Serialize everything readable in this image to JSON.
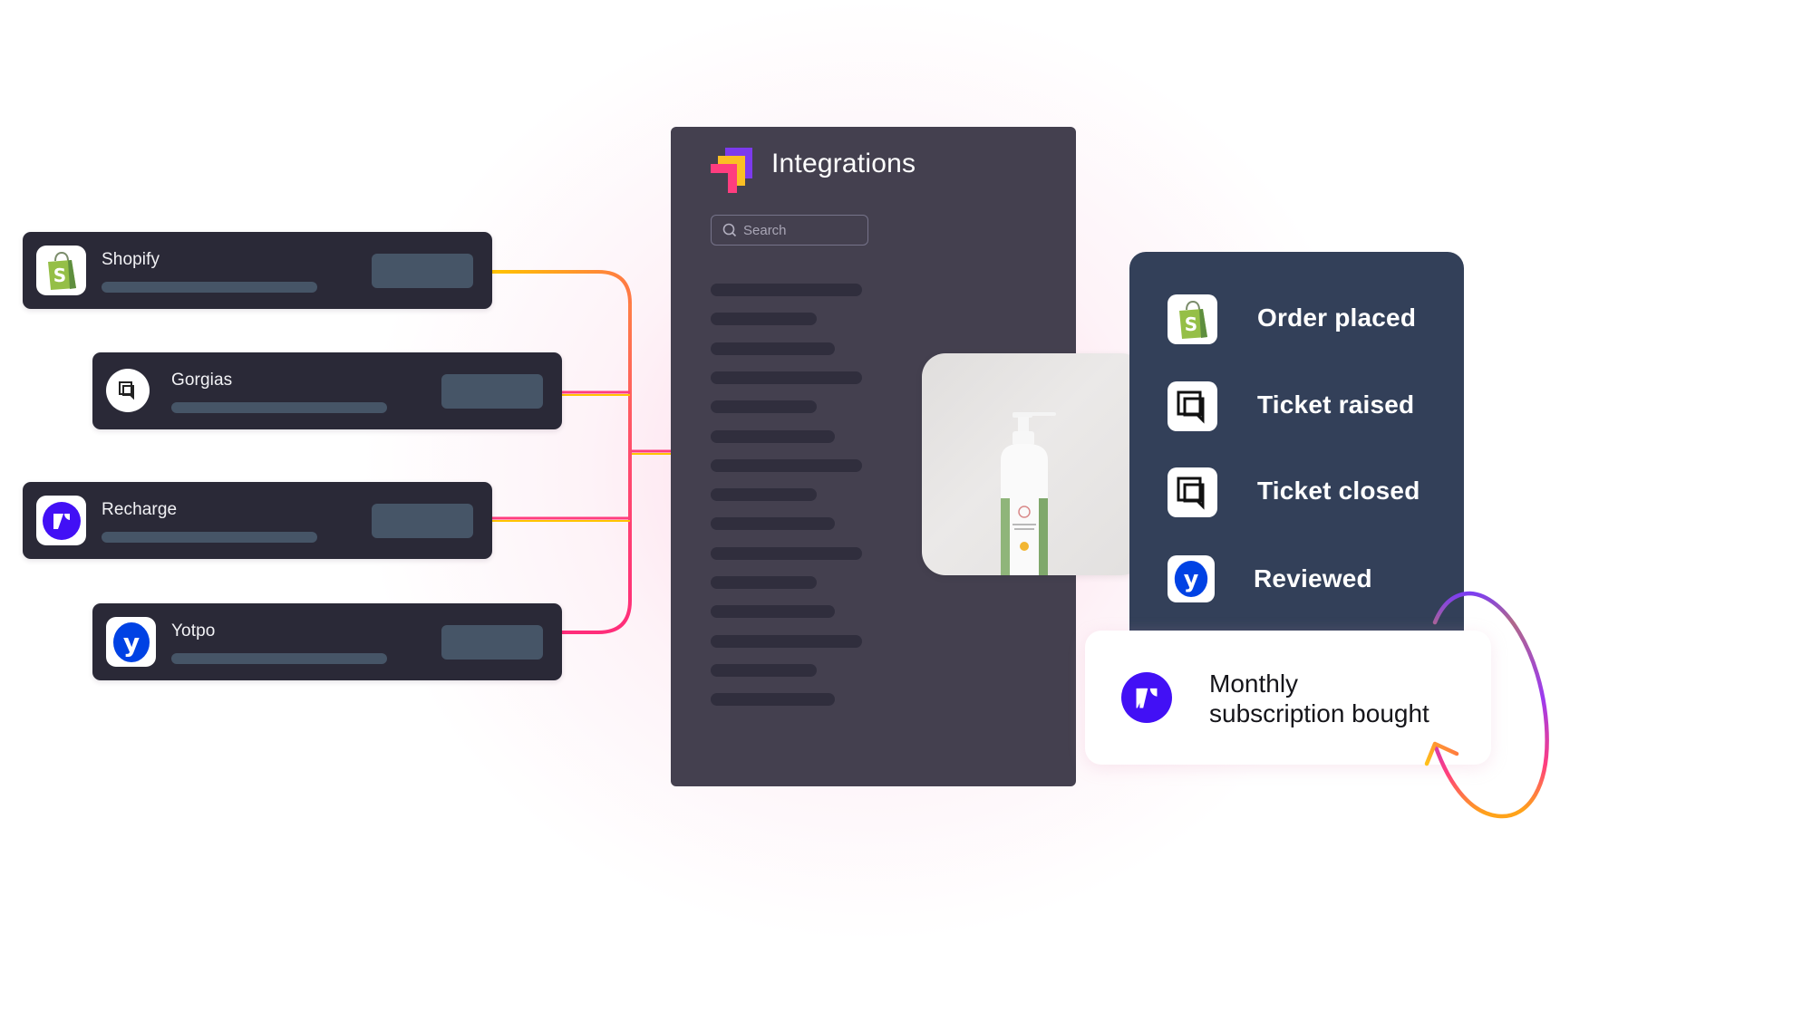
{
  "integrations_panel": {
    "title": "Integrations",
    "search": {
      "placeholder": "Search",
      "value": ""
    },
    "logo_icon": "integrations-logo-icon",
    "placeholder_rows": 15
  },
  "integration_cards": [
    {
      "name": "Shopify",
      "icon": "shopify-bag-icon"
    },
    {
      "name": "Gorgias",
      "icon": "gorgias-chat-icon"
    },
    {
      "name": "Recharge",
      "icon": "recharge-logo-icon"
    },
    {
      "name": "Yotpo",
      "icon": "yotpo-logo-icon"
    }
  ],
  "events": [
    {
      "label": "Order placed",
      "icon": "shopify-bag-icon"
    },
    {
      "label": "Ticket raised",
      "icon": "gorgias-chat-icon"
    },
    {
      "label": "Ticket closed",
      "icon": "gorgias-chat-icon"
    },
    {
      "label": "Reviewed",
      "icon": "yotpo-logo-icon"
    }
  ],
  "subscription_event": {
    "line1": "Monthly",
    "line2": "subscription bought",
    "icon": "recharge-logo-icon"
  },
  "product_image": {
    "subject": "white pump bottle with green label"
  },
  "colors": {
    "brand_pink": "#ff3d7f",
    "brand_yellow": "#fbbf24",
    "brand_purple": "#7c3aed",
    "card_dark": "#2a2937",
    "panel": "#44404f",
    "events_panel": "#334059",
    "shopify_green": "#95bf47",
    "recharge_purple": "#4210f5",
    "yotpo_blue": "#0042e4"
  }
}
